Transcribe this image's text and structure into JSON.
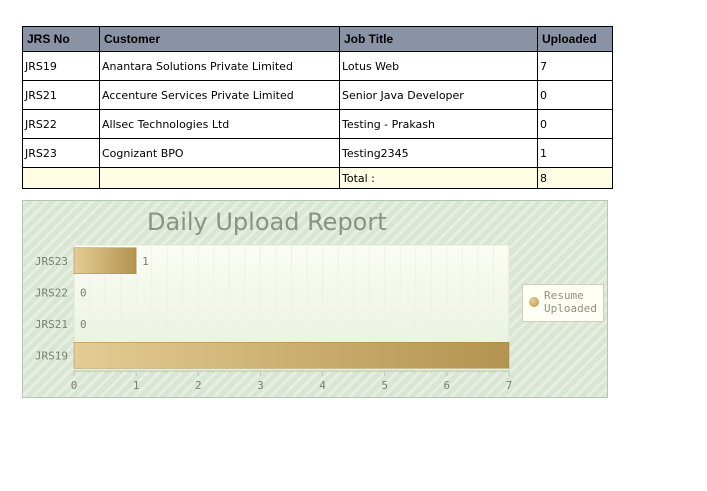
{
  "table": {
    "headers": [
      "JRS No",
      "Customer",
      "Job Title",
      "Uploaded"
    ],
    "rows": [
      [
        "JRS19",
        "Anantara Solutions Private Limited",
        "Lotus Web",
        "7"
      ],
      [
        "JRS21",
        "Accenture Services Private Limited",
        "Senior Java Developer",
        "0"
      ],
      [
        "JRS22",
        "Allsec Technologies Ltd",
        "Testing - Prakash",
        "0"
      ],
      [
        "JRS23",
        "Cognizant BPO",
        "Testing2345",
        "1"
      ]
    ],
    "total_label": "Total :",
    "total_value": "8"
  },
  "chart_data": {
    "type": "bar",
    "orientation": "horizontal",
    "title": "Daily Upload Report",
    "categories": [
      "JRS23",
      "JRS22",
      "JRS21",
      "JRS19"
    ],
    "series": [
      {
        "name": "Resume Uploaded",
        "values": [
          1,
          0,
          0,
          7
        ],
        "color": "#b99a55"
      }
    ],
    "xlim": [
      0,
      7
    ],
    "x_ticks": [
      "0",
      "1",
      "2",
      "3",
      "4",
      "5",
      "6",
      "7"
    ],
    "grid": true,
    "legend_position": "right"
  },
  "legend": {
    "label": "Resume Uploaded"
  }
}
